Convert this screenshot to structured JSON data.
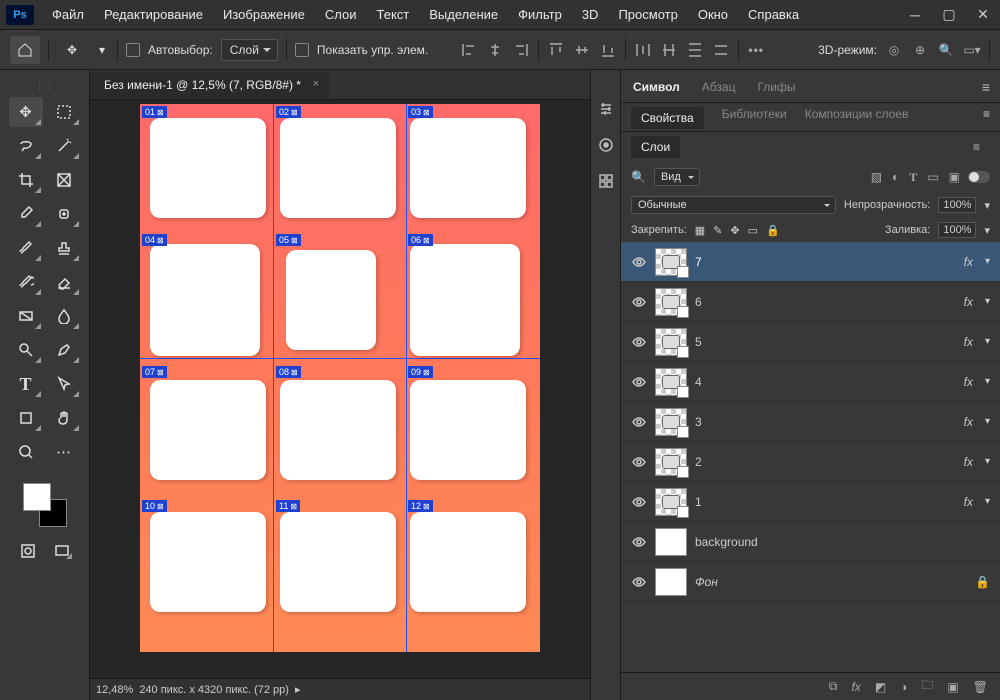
{
  "app_logo": "Ps",
  "menu": [
    "Файл",
    "Редактирование",
    "Изображение",
    "Слои",
    "Текст",
    "Выделение",
    "Фильтр",
    "3D",
    "Просмотр",
    "Окно",
    "Справка"
  ],
  "options": {
    "autopick": "Автовыбор:",
    "layer_sel": "Слой",
    "show_controls": "Показать упр. элем.",
    "mode3d": "3D-режим:"
  },
  "doc": {
    "tab_title": "Без имени-1 @ 12,5% (7, RGB/8#) *",
    "status_zoom": "12,48%",
    "status_dims": "240 пикс. x 4320 пикс. (72 pp)",
    "slices": [
      "01",
      "02",
      "03",
      "04",
      "05",
      "06",
      "07",
      "08",
      "09",
      "10",
      "11",
      "12"
    ]
  },
  "panels": {
    "char_tabs": [
      "Символ",
      "Абзац",
      "Глифы"
    ],
    "prop_tabs": [
      "Свойства",
      "Библиотеки",
      "Композиции слоев"
    ],
    "layers_tab": "Слои",
    "filter_label": "Вид",
    "blend_mode": "Обычные",
    "opacity_label": "Непрозрачность:",
    "opacity_val": "100%",
    "lock_label": "Закрепить:",
    "fill_label": "Заливка:",
    "fill_val": "100%",
    "layers": [
      {
        "name": "7",
        "fx": true,
        "sel": true,
        "thumb": "shape"
      },
      {
        "name": "6",
        "fx": true,
        "thumb": "shape"
      },
      {
        "name": "5",
        "fx": true,
        "thumb": "shape"
      },
      {
        "name": "4",
        "fx": true,
        "thumb": "shape"
      },
      {
        "name": "3",
        "fx": true,
        "thumb": "shape"
      },
      {
        "name": "2",
        "fx": true,
        "thumb": "shape"
      },
      {
        "name": "1",
        "fx": true,
        "thumb": "shape"
      },
      {
        "name": "background",
        "fx": false,
        "thumb": "white"
      },
      {
        "name": "Фон",
        "fx": false,
        "thumb": "white",
        "locked": true,
        "italic": true
      }
    ]
  },
  "search_icon": "🔍"
}
